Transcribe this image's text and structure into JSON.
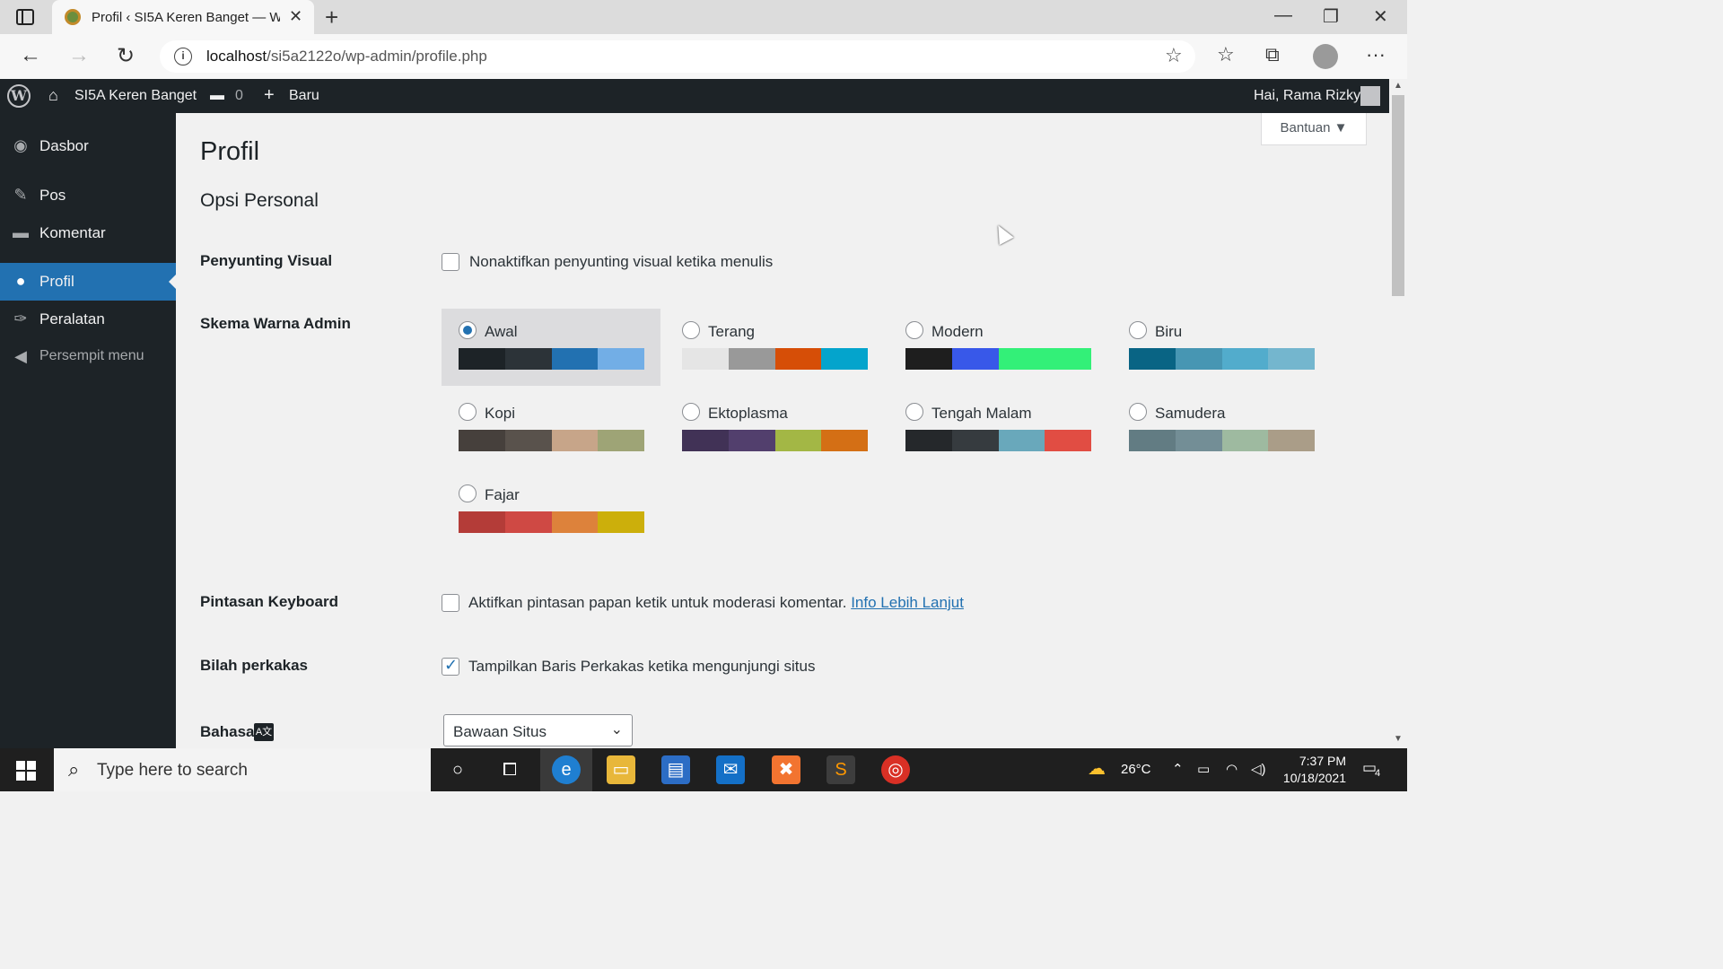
{
  "browser": {
    "tab_title": "Profil ‹ SI5A Keren Banget — Wo",
    "url_host": "localhost",
    "url_path": "/si5a2122o/wp-admin/profile.php"
  },
  "adminbar": {
    "site_name": "SI5A Keren Banget",
    "comments_count": "0",
    "new_label": "Baru",
    "greeting": "Hai, Rama Rizky"
  },
  "sidebar": {
    "items": [
      {
        "label": "Dasbor",
        "icon": "dashboard-icon"
      },
      {
        "label": "Pos",
        "icon": "pin-icon"
      },
      {
        "label": "Komentar",
        "icon": "comment-icon"
      },
      {
        "label": "Profil",
        "icon": "user-icon"
      },
      {
        "label": "Peralatan",
        "icon": "wrench-icon"
      },
      {
        "label": "Persempit menu",
        "icon": "collapse-icon"
      }
    ]
  },
  "help_button": "Bantuan ▼",
  "page_title": "Profil",
  "section_title": "Opsi Personal",
  "visual_editor": {
    "label": "Penyunting Visual",
    "option": "Nonaktifkan penyunting visual ketika menulis",
    "checked": false
  },
  "color_scheme": {
    "label": "Skema Warna Admin",
    "selected": "Awal",
    "schemes": [
      {
        "name": "Awal",
        "colors": [
          "#1d2327",
          "#2c3338",
          "#2271b1",
          "#72aee6"
        ]
      },
      {
        "name": "Terang",
        "colors": [
          "#e5e5e5",
          "#999999",
          "#d64e07",
          "#04a4cc"
        ]
      },
      {
        "name": "Modern",
        "colors": [
          "#1e1e1e",
          "#3858e9",
          "#33f078",
          "#33f078"
        ]
      },
      {
        "name": "Biru",
        "colors": [
          "#096484",
          "#4796b3",
          "#52accc",
          "#74b6ce"
        ]
      },
      {
        "name": "Kopi",
        "colors": [
          "#46403c",
          "#59524c",
          "#c7a589",
          "#9ea476"
        ]
      },
      {
        "name": "Ektoplasma",
        "colors": [
          "#413256",
          "#523f6d",
          "#a3b745",
          "#d46f15"
        ]
      },
      {
        "name": "Tengah Malam",
        "colors": [
          "#25282b",
          "#363b3f",
          "#69a8bb",
          "#e14d43"
        ]
      },
      {
        "name": "Samudera",
        "colors": [
          "#627c83",
          "#738e96",
          "#9ebaa0",
          "#aa9d88"
        ]
      },
      {
        "name": "Fajar",
        "colors": [
          "#b43c38",
          "#cf4944",
          "#dd823b",
          "#ccaf0b"
        ]
      }
    ]
  },
  "keyboard_shortcuts": {
    "label": "Pintasan Keyboard",
    "option": "Aktifkan pintasan papan ketik untuk moderasi komentar.",
    "link": "Info Lebih Lanjut",
    "checked": false
  },
  "toolbar": {
    "label": "Bilah perkakas",
    "option": "Tampilkan Baris Perkakas ketika mengunjungi situs",
    "checked": true
  },
  "language": {
    "label": "Bahasa",
    "value": "Bawaan Situs"
  },
  "taskbar": {
    "search_placeholder": "Type here to search",
    "temperature": "26°C",
    "time": "7:37 PM",
    "date": "10/18/2021",
    "notifications": "4"
  }
}
